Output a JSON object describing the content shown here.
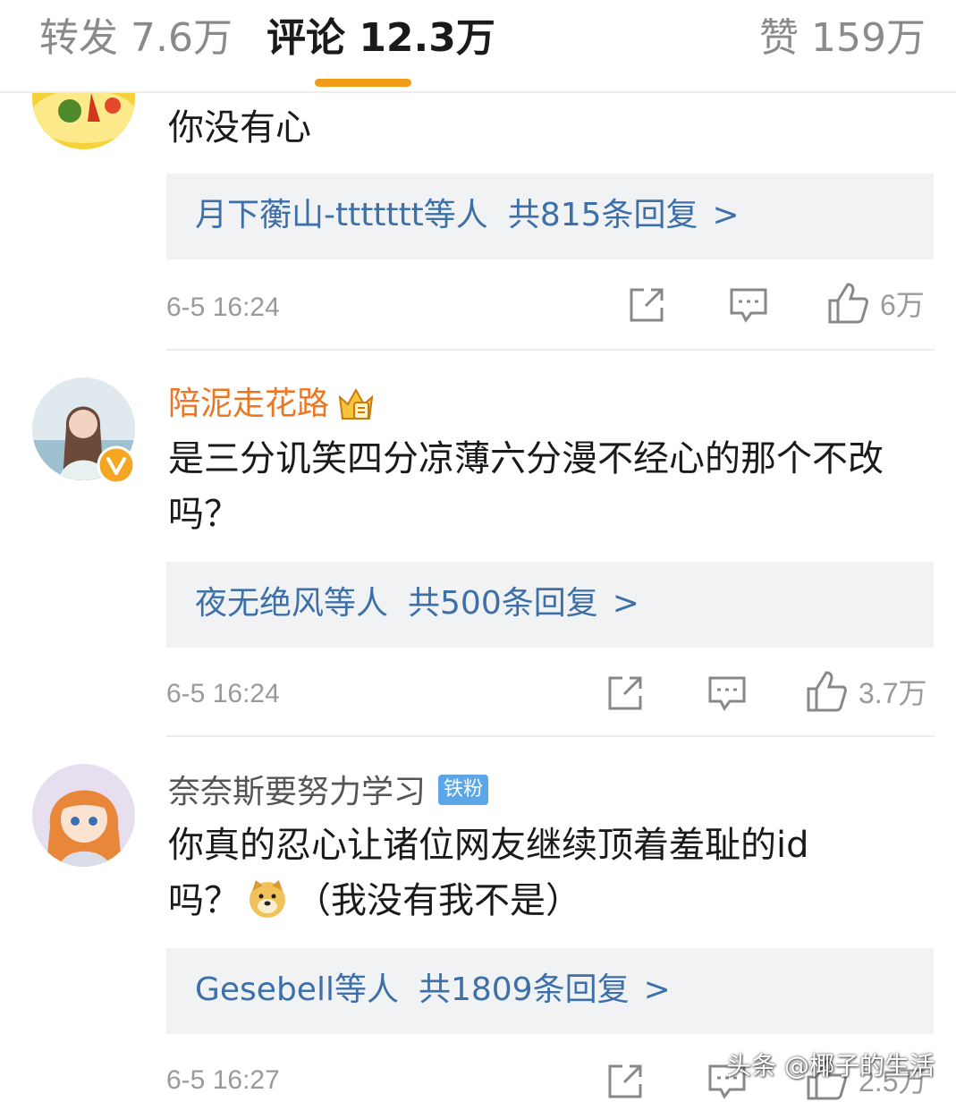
{
  "tabs": {
    "repost": "转发 7.6万",
    "comment": "评论 12.3万",
    "like": "赞 159万"
  },
  "comments": [
    {
      "text": "你没有心",
      "reply_users": "月下蘅山-ttttttt等人",
      "reply_count": "共815条回复",
      "reply_chevron": ">",
      "time": "6-5 16:24",
      "likes": "6万"
    },
    {
      "username": "陪泥走花路",
      "text": "是三分讥笑四分凉薄六分漫不经心的那个不改吗？",
      "reply_users": "夜无绝风等人",
      "reply_count": "共500条回复",
      "reply_chevron": ">",
      "time": "6-5 16:24",
      "likes": "3.7万"
    },
    {
      "username": "奈奈斯要努力学习",
      "badge": "铁粉",
      "text_line1": "你真的忍心让诸位网友继续顶着羞耻的id",
      "text_line2_a": "吗？",
      "text_line2_b": "（我没有我不是）",
      "reply_users": "Gesebell等人",
      "reply_count": "共1809条回复",
      "reply_chevron": ">",
      "time": "6-5 16:27",
      "likes": "2.5万"
    }
  ],
  "watermark": "头条 @椰子的生活",
  "colors": {
    "accent": "#f39c1a",
    "link": "#3d6fa8",
    "vip_name": "#ee7622",
    "fan_badge": "#5aa6e6"
  }
}
